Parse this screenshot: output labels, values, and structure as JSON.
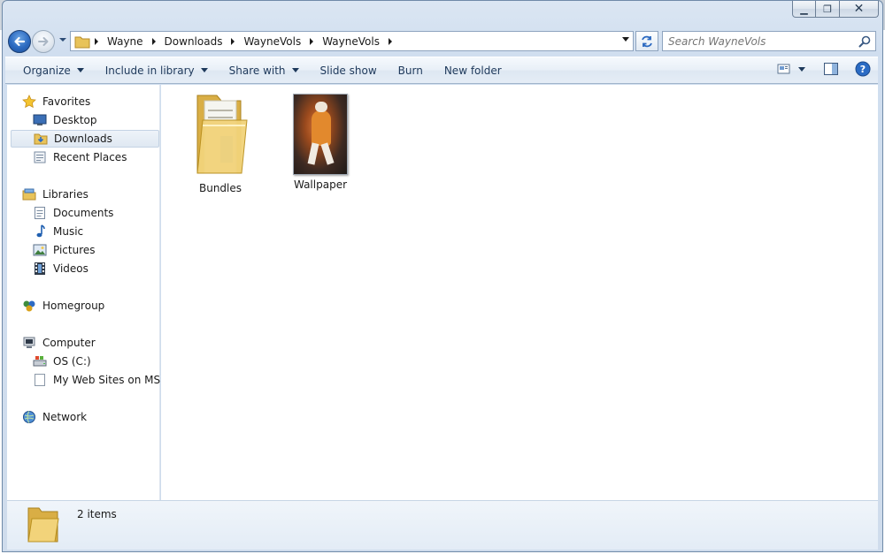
{
  "window": {
    "caption": {
      "minimize": "▁",
      "maximize": "❐",
      "close": "✕"
    }
  },
  "address": {
    "crumbs": [
      "Wayne",
      "Downloads",
      "WayneVols",
      "WayneVols"
    ]
  },
  "search": {
    "placeholder": "Search WayneVols"
  },
  "toolbar": {
    "organize": "Organize",
    "include_in_library": "Include in library",
    "share_with": "Share with",
    "slide_show": "Slide show",
    "burn": "Burn",
    "new_folder": "New folder"
  },
  "nav": {
    "favorites": {
      "label": "Favorites",
      "items": [
        "Desktop",
        "Downloads",
        "Recent Places"
      ]
    },
    "libraries": {
      "label": "Libraries",
      "items": [
        "Documents",
        "Music",
        "Pictures",
        "Videos"
      ]
    },
    "homegroup": {
      "label": "Homegroup"
    },
    "computer": {
      "label": "Computer",
      "items": [
        "OS (C:)",
        "My Web Sites on MSN"
      ]
    },
    "network": {
      "label": "Network"
    },
    "selected": "Downloads"
  },
  "files": [
    {
      "name": "Bundles",
      "type": "folder",
      "icon": "folder-icon"
    },
    {
      "name": "Wallpaper",
      "type": "image",
      "icon": "image-thumbnail"
    }
  ],
  "details": {
    "count": "2 items"
  },
  "colors": {
    "accent": "#1e395b",
    "selection": "#dfe8f2"
  }
}
